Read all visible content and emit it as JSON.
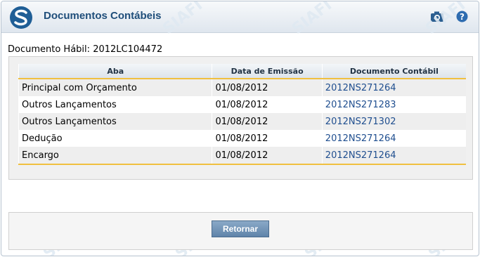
{
  "window": {
    "title": "Documentos Contábeis",
    "watermark_text": "SIAFI"
  },
  "header_icons": [
    "siafi-logo-icon",
    "camera-icon",
    "help-icon"
  ],
  "colors": {
    "title": "#1f4e7a",
    "link": "#1f4e8f",
    "accent_border": "#f0c040",
    "button": "#6f92b6"
  },
  "document": {
    "label": "Documento Hábil:",
    "value": "2012LC104472"
  },
  "table": {
    "headers": [
      "Aba",
      "Data de Emissão",
      "Documento Contábil"
    ],
    "rows": [
      {
        "aba": "Principal com Orçamento",
        "data": "01/08/2012",
        "doc": "2012NS271264"
      },
      {
        "aba": "Outros Lançamentos",
        "data": "01/08/2012",
        "doc": "2012NS271283"
      },
      {
        "aba": "Outros Lançamentos",
        "data": "01/08/2012",
        "doc": "2012NS271302"
      },
      {
        "aba": "Dedução",
        "data": "01/08/2012",
        "doc": "2012NS271264"
      },
      {
        "aba": "Encargo",
        "data": "01/08/2012",
        "doc": "2012NS271264"
      }
    ]
  },
  "footer": {
    "return_label": "Retornar"
  }
}
